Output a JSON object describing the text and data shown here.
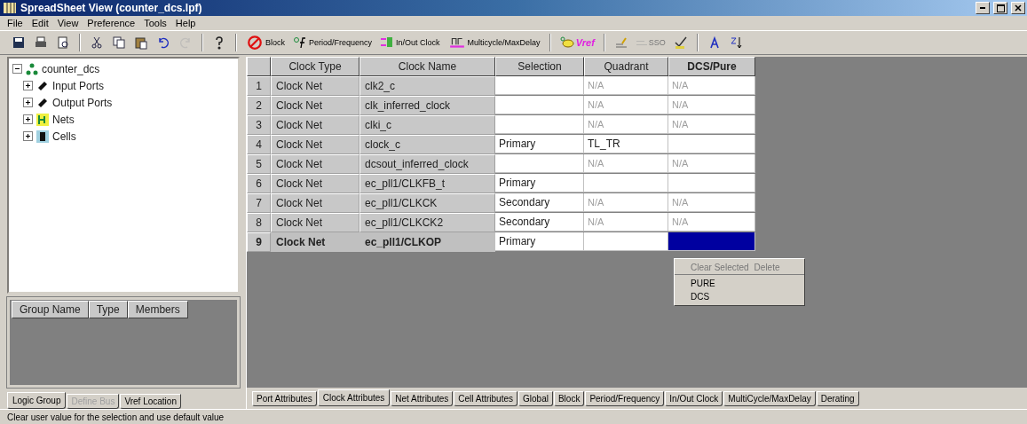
{
  "window": {
    "title": "SpreadSheet View (counter_dcs.lpf)"
  },
  "menu": [
    "File",
    "Edit",
    "View",
    "Preference",
    "Tools",
    "Help"
  ],
  "toolbar": [
    {
      "kind": "icon",
      "disabled": false
    },
    {
      "kind": "icon",
      "disabled": false
    },
    {
      "kind": "icon",
      "disabled": false
    },
    {
      "kind": "separator"
    },
    {
      "kind": "icon",
      "disabled": false
    },
    {
      "kind": "icon",
      "disabled": false
    },
    {
      "kind": "icon",
      "disabled": false
    },
    {
      "kind": "icon",
      "disabled": false
    },
    {
      "kind": "icon",
      "disabled": true
    },
    {
      "kind": "separator"
    },
    {
      "kind": "icon",
      "disabled": false
    },
    {
      "kind": "separator"
    },
    {
      "kind": "labeled",
      "label": "Block",
      "disabled": false
    },
    {
      "kind": "labeled",
      "label": "Period/Frequency",
      "disabled": false
    },
    {
      "kind": "labeled",
      "label": "In/Out Clock",
      "disabled": false
    },
    {
      "kind": "labeled",
      "label": "Multicycle/MaxDelay",
      "disabled": false
    },
    {
      "kind": "separator"
    },
    {
      "kind": "labeled",
      "label": "Vref",
      "disabled": false
    },
    {
      "kind": "separator"
    },
    {
      "kind": "icon",
      "disabled": false
    },
    {
      "kind": "labeled",
      "label": "SSO",
      "disabled": true
    },
    {
      "kind": "icon",
      "disabled": false
    },
    {
      "kind": "separator"
    },
    {
      "kind": "icon",
      "disabled": false
    },
    {
      "kind": "icon",
      "disabled": false
    }
  ],
  "tree": {
    "label": "counter_dcs",
    "expanded": true,
    "children": [
      {
        "label": "Input Ports",
        "expanded": false
      },
      {
        "label": "Output Ports",
        "expanded": false
      },
      {
        "label": "Nets",
        "expanded": false
      },
      {
        "label": "Cells",
        "expanded": false
      }
    ]
  },
  "group_table": {
    "columns": [
      "Group Name",
      "Type",
      "Members"
    ]
  },
  "left_tabs": [
    {
      "label": "Logic Group",
      "selected": true,
      "disabled": false
    },
    {
      "label": "Define Bus",
      "selected": false,
      "disabled": true
    },
    {
      "label": "Vref Location",
      "selected": false,
      "disabled": false
    }
  ],
  "table": {
    "columns": [
      {
        "label": "Clock Type",
        "active": false
      },
      {
        "label": "Clock Name",
        "active": false
      },
      {
        "label": "Selection",
        "active": false
      },
      {
        "label": "Quadrant",
        "active": false
      },
      {
        "label": "DCS/Pure",
        "active": true
      }
    ],
    "rows": [
      {
        "number": "1",
        "selected": false,
        "clock_type": "Clock Net",
        "clock_name": "clk2_c",
        "quadrant": {
          "text": "N/A",
          "dim": true
        },
        "dcs_pure": {
          "text": "N/A",
          "dim": true,
          "highlighted": false
        }
      },
      {
        "number": "2",
        "selected": false,
        "clock_type": "Clock Net",
        "clock_name": "clk_inferred_clock",
        "quadrant": {
          "text": "N/A",
          "dim": true
        },
        "dcs_pure": {
          "text": "N/A",
          "dim": true,
          "highlighted": false
        }
      },
      {
        "number": "3",
        "selected": false,
        "clock_type": "Clock Net",
        "clock_name": "clki_c",
        "quadrant": {
          "text": "N/A",
          "dim": true
        },
        "dcs_pure": {
          "text": "N/A",
          "dim": true,
          "highlighted": false
        }
      },
      {
        "number": "4",
        "selected": false,
        "clock_type": "Clock Net",
        "clock_name": "clock_c",
        "selection": "Primary",
        "quadrant": {
          "text": "TL_TR",
          "dim": false
        },
        "dcs_pure": {
          "highlighted": false
        }
      },
      {
        "number": "5",
        "selected": false,
        "clock_type": "Clock Net",
        "clock_name": "dcsout_inferred_clock",
        "quadrant": {
          "text": "N/A",
          "dim": true
        },
        "dcs_pure": {
          "text": "N/A",
          "dim": true,
          "highlighted": false
        }
      },
      {
        "number": "6",
        "selected": false,
        "clock_type": "Clock Net",
        "clock_name": "ec_pll1/CLKFB_t",
        "selection": "Primary",
        "quadrant": {},
        "dcs_pure": {
          "highlighted": false
        }
      },
      {
        "number": "7",
        "selected": false,
        "clock_type": "Clock Net",
        "clock_name": "ec_pll1/CLKCK",
        "selection": "Secondary",
        "quadrant": {
          "text": "N/A",
          "dim": true
        },
        "dcs_pure": {
          "text": "N/A",
          "dim": true,
          "highlighted": false
        }
      },
      {
        "number": "8",
        "selected": false,
        "clock_type": "Clock Net",
        "clock_name": "ec_pll1/CLKCK2",
        "selection": "Secondary",
        "quadrant": {
          "text": "N/A",
          "dim": true
        },
        "dcs_pure": {
          "text": "N/A",
          "dim": true,
          "highlighted": false
        }
      },
      {
        "number": "9",
        "selected": true,
        "clock_type": "Clock Net",
        "clock_name": "ec_pll1/CLKOP",
        "selection": "Primary",
        "quadrant": {},
        "dcs_pure": {
          "highlighted": true
        }
      }
    ]
  },
  "context_menu": {
    "top_items": [
      {
        "label": "Clear Selected",
        "disabled": true
      },
      {
        "label": "Delete",
        "disabled": true
      }
    ],
    "items": [
      {
        "label": "PURE",
        "disabled": false
      },
      {
        "label": "DCS",
        "disabled": false
      }
    ]
  },
  "bottom_tabs": [
    {
      "label": "Port Attributes",
      "selected": false
    },
    {
      "label": "Clock Attributes",
      "selected": true
    },
    {
      "label": "Net Attributes",
      "selected": false
    },
    {
      "label": "Cell Attributes",
      "selected": false
    },
    {
      "label": "Global",
      "selected": false
    },
    {
      "label": "Block",
      "selected": false
    },
    {
      "label": "Period/Frequency",
      "selected": false
    },
    {
      "label": "In/Out Clock",
      "selected": false
    },
    {
      "label": "MultiCycle/MaxDelay",
      "selected": false
    },
    {
      "label": "Derating",
      "selected": false
    }
  ],
  "status_bar": "Clear user value for the selection and use default value"
}
